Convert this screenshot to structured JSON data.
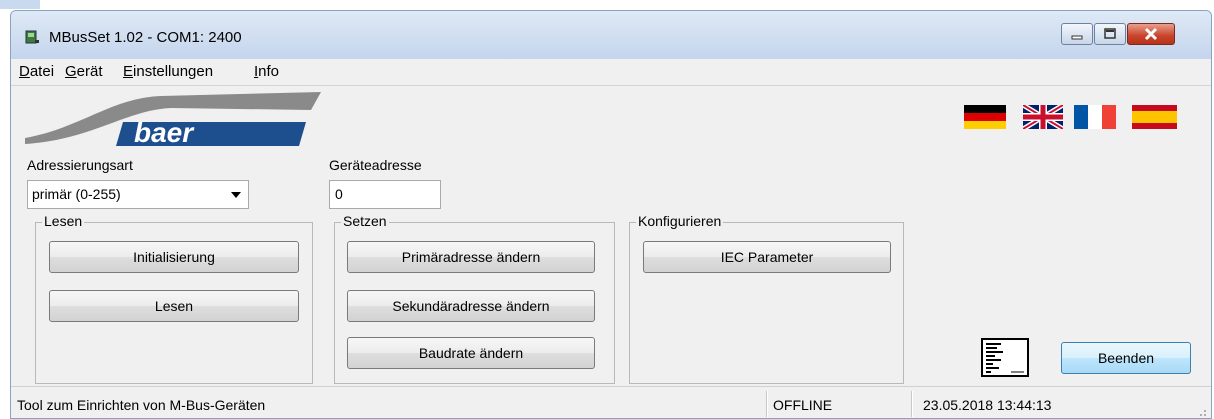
{
  "window": {
    "title": "MBusSet 1.02 - COM1: 2400",
    "controls": [
      "minimize",
      "maximize",
      "close"
    ]
  },
  "menu": [
    {
      "label": "Datei",
      "mnemonic": "D",
      "rest": "atei"
    },
    {
      "label": "Gerät",
      "mnemonic": "G",
      "rest": "erät"
    },
    {
      "label": "Einstellungen",
      "mnemonic": "E",
      "rest": "instellungen"
    },
    {
      "label": "Info",
      "mnemonic": "I",
      "rest": "nfo"
    }
  ],
  "logo": {
    "text": "baer",
    "color": "#1d4f8f"
  },
  "languages": [
    "de",
    "en",
    "fr",
    "es"
  ],
  "addressing": {
    "label": "Adressierungsart",
    "selected": "primär (0-255)"
  },
  "device_address": {
    "label": "Geräteadresse",
    "value": "0"
  },
  "groups": {
    "lesen": {
      "title": "Lesen",
      "buttons": [
        "Initialisierung",
        "Lesen"
      ]
    },
    "setzen": {
      "title": "Setzen",
      "buttons": [
        "Primäradresse ändern",
        "Sekundäradresse ändern",
        "Baudrate ändern"
      ]
    },
    "konfigurieren": {
      "title": "Konfigurieren",
      "buttons": [
        "IEC Parameter"
      ]
    }
  },
  "actions": {
    "exit_label": "Beenden"
  },
  "status": {
    "message": "Tool zum Einrichten von M-Bus-Geräten",
    "connection": "OFFLINE",
    "datetime": "23.05.2018 13:44:13"
  }
}
